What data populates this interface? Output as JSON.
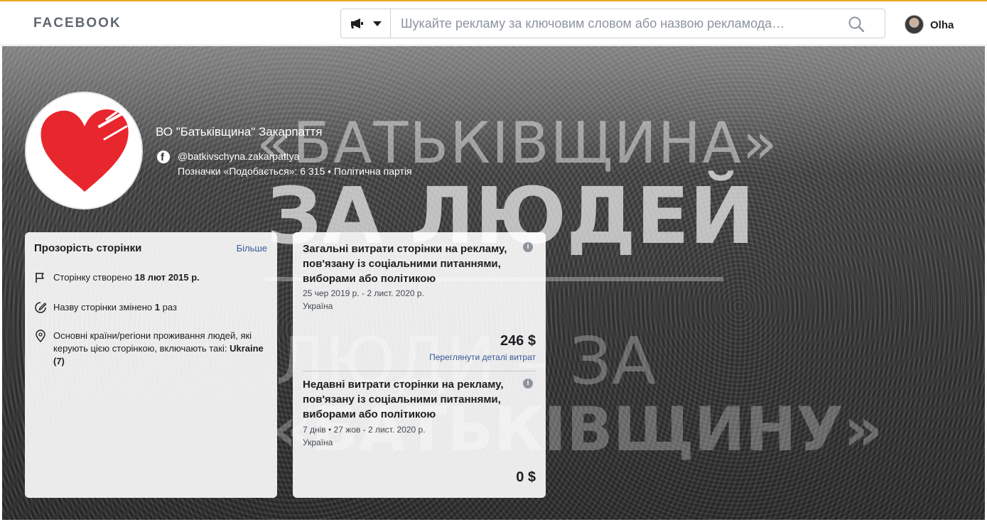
{
  "header": {
    "brand": "FACEBOOK",
    "search_placeholder": "Шукайте рекламу за ключовим словом або назвою рекламода…",
    "ad_type_icon": "megaphone-icon",
    "search_icon": "search-icon",
    "user_name": "Olha"
  },
  "cover": {
    "poster_lines": [
      "«БАТЬКІВЩИНА»",
      "ЗА ЛЮДЕЙ",
      "ЛЮДИ – ЗА",
      "«БАТЬКІВЩИНУ»"
    ]
  },
  "page": {
    "name": "ВО \"Батьківщина\" Закарпаття",
    "handle": "@batkivschyna.zakarpattya",
    "likes_line": "Позначки «Подобається»: 6 315 • Політична партія"
  },
  "transparency": {
    "title": "Прозорість сторінки",
    "more": "Більше",
    "created_prefix": "Сторінку створено ",
    "created_date": "18 лют 2015 р.",
    "renamed_prefix": "Назву сторінки змінено ",
    "renamed_count": "1",
    "renamed_suffix": " раз",
    "countries_text": "Основні країни/регіони проживання людей, які керують цією сторінкою, включають такі: ",
    "countries_value": "Ukraine (7)"
  },
  "spending": {
    "total": {
      "title": "Загальні витрати сторінки на рекламу, пов'язану із соціальними питаннями, виборами або політикою",
      "dates": "25 чер 2019 р. - 2 лист. 2020 р.",
      "country": "Україна",
      "amount": "246 $",
      "details_link": "Переглянути деталі витрат"
    },
    "recent": {
      "title": "Недавні витрати сторінки на рекламу, пов'язану із соціальними питаннями, виборами або політикою",
      "dates": "7 днів • 27 жов - 2 лист. 2020 р.",
      "country": "Україна",
      "amount": "0 $"
    }
  },
  "colors": {
    "accent_bar": "#e9a825",
    "link": "#385898",
    "heart": "#e8262d"
  }
}
